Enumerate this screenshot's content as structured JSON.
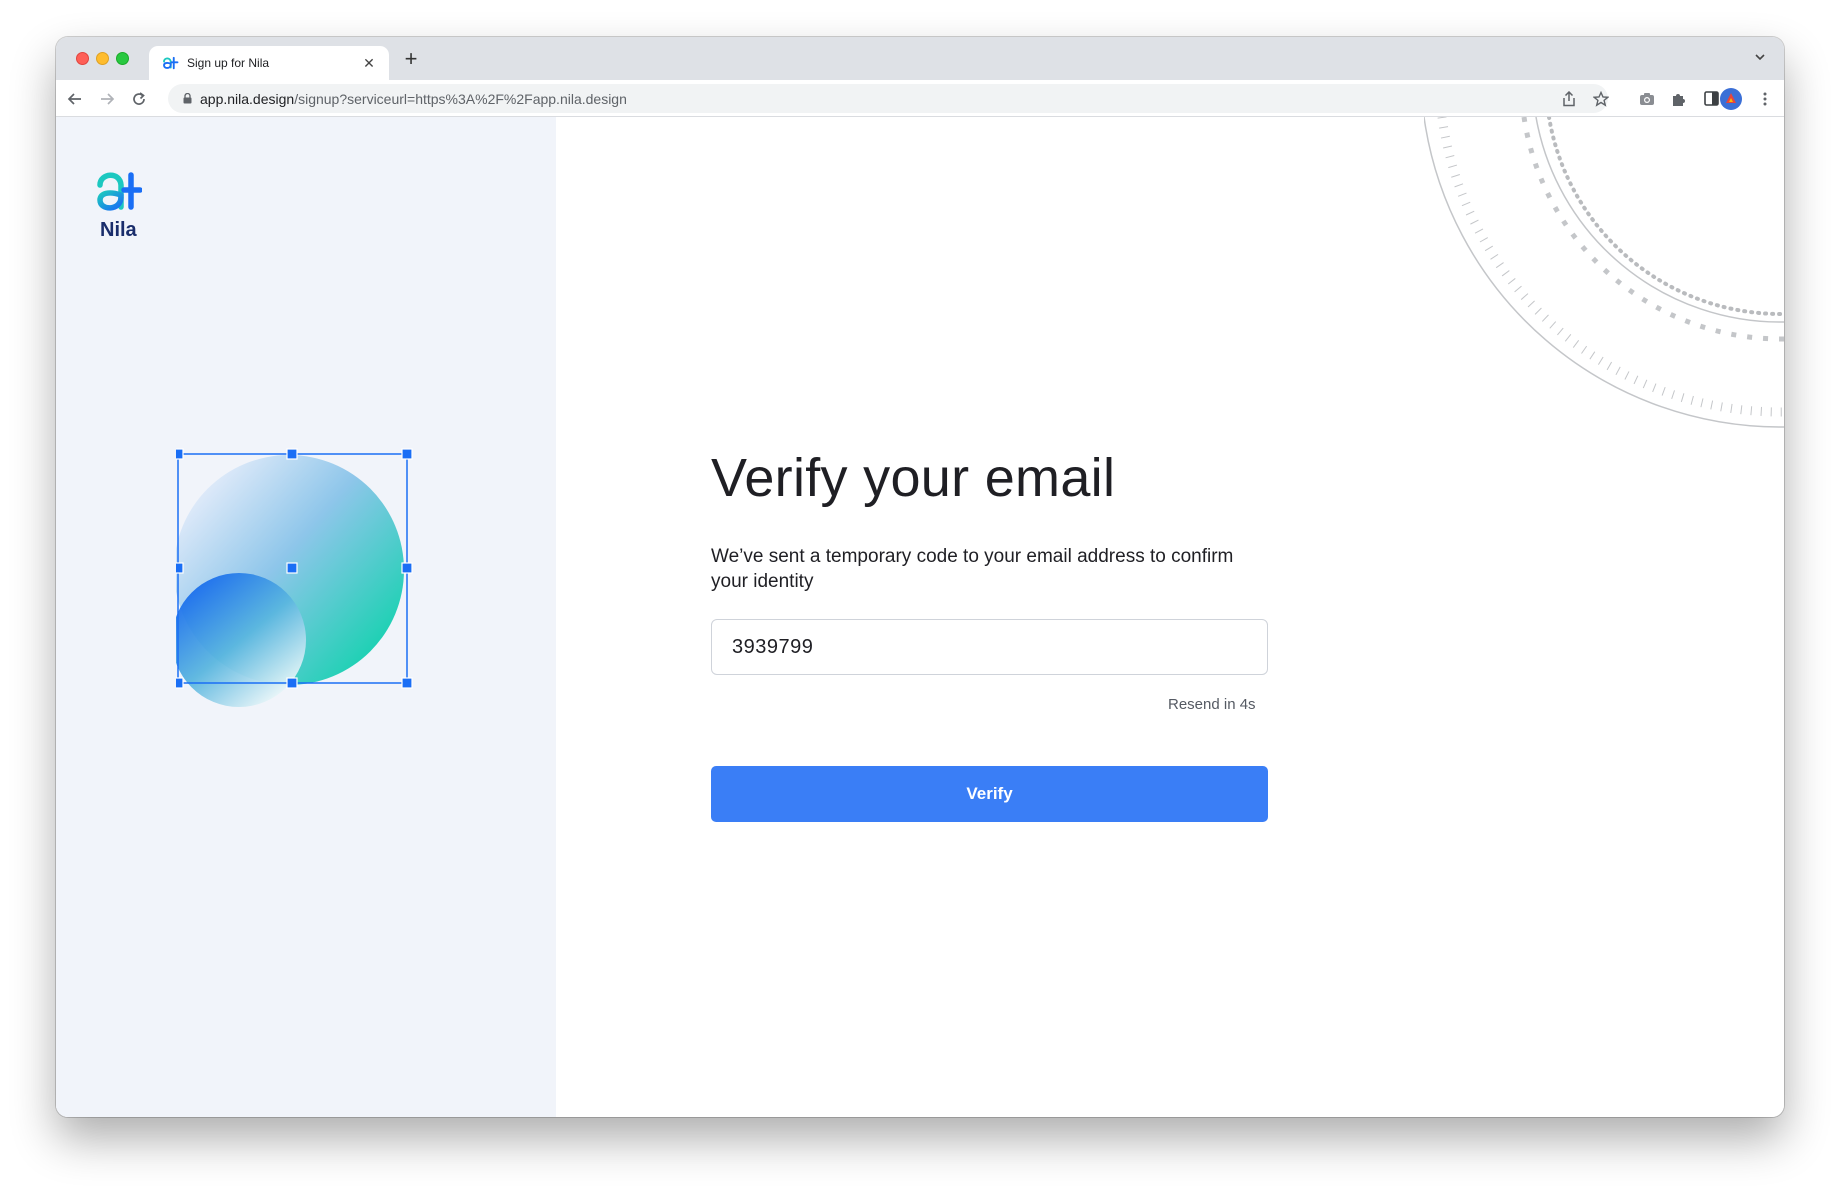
{
  "browser": {
    "tab_title": "Sign up for Nila",
    "tab_close": "✕",
    "new_tab": "+",
    "url_host": "app.nila.design",
    "url_path": "/signup?serviceurl=https%3A%2F%2Fapp.nila.design"
  },
  "brand": {
    "name": "Nila",
    "colors": {
      "teal": "#1cc8c0",
      "blue": "#1a6ef5",
      "navy": "#1a2d6b"
    }
  },
  "form": {
    "heading": "Verify your email",
    "subtitle": "We’ve sent a temporary code to your email address to confirm your identity",
    "code_value": "3939799",
    "resend_text": "Resend in 4s",
    "verify_label": "Verify",
    "accent_color": "#3a7ef6"
  }
}
